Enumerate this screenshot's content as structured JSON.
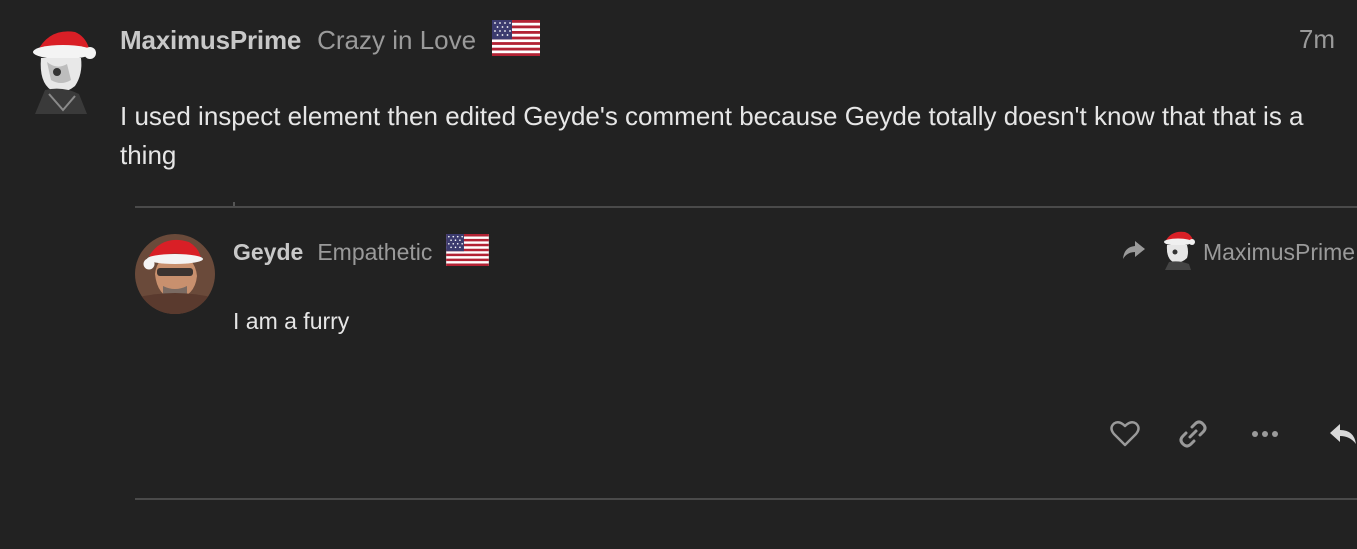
{
  "post": {
    "author": "MaximusPrime",
    "user_title": "Crazy in Love",
    "flag_icon": "us-flag-icon",
    "timestamp": "7m",
    "body": "I used inspect element then edited Geyde's comment because Geyde totally doesn't know that that is a thing"
  },
  "quoted_reply": {
    "author": "Geyde",
    "user_title": "Empathetic",
    "flag_icon": "us-flag-icon",
    "body": "I am a furry",
    "reply_to": {
      "icon": "share-arrow-icon",
      "name": "MaximusPrime"
    }
  },
  "actions": [
    {
      "name": "like",
      "icon": "heart-icon"
    },
    {
      "name": "copy-link",
      "icon": "link-icon"
    },
    {
      "name": "more",
      "icon": "ellipsis-icon"
    },
    {
      "name": "reply",
      "icon": "reply-arrow-icon"
    }
  ],
  "colors": {
    "background": "#222222",
    "divider": "#4a4a4a",
    "username": "#c8c8c8",
    "muted": "#9a9a9a",
    "body_text": "#e6e6e6",
    "santa_hat_red": "#d91f26"
  }
}
